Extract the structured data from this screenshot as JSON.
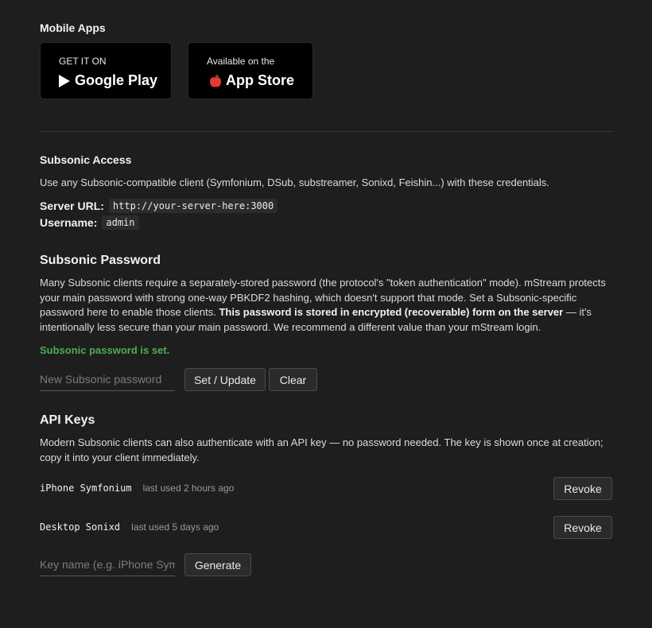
{
  "mobile": {
    "heading": "Mobile Apps",
    "google": {
      "small": "GET IT ON",
      "big": "Google Play"
    },
    "apple": {
      "small": "Available on the",
      "big": "App Store"
    }
  },
  "subsonic_access": {
    "heading": "Subsonic Access",
    "description": "Use any Subsonic-compatible client (Symfonium, DSub, substreamer, Sonixd, Feishin...) with these credentials.",
    "server_url_label": "Server URL:",
    "server_url_value": "http://your-server-here:3000",
    "username_label": "Username:",
    "username_value": "admin"
  },
  "subsonic_password": {
    "heading": "Subsonic Password",
    "para_before": "Many Subsonic clients require a separately-stored password (the protocol's \"token authentication\" mode). mStream protects your main password with strong one-way PBKDF2 hashing, which doesn't support that mode. Set a Subsonic-specific password here to enable those clients. ",
    "para_bold": "This password is stored in encrypted (recoverable) form on the server",
    "para_after": " — it's intentionally less secure than your main password. We recommend a different value than your mStream login.",
    "status": "Subsonic password is set.",
    "input_placeholder": "New Subsonic password",
    "set_button": "Set / Update",
    "clear_button": "Clear"
  },
  "api_keys": {
    "heading": "API Keys",
    "description": "Modern Subsonic clients can also authenticate with an API key — no password needed. The key is shown once at creation; copy it into your client immediately.",
    "keys": [
      {
        "name": "iPhone Symfonium",
        "meta": "last used 2 hours ago",
        "action": "Revoke"
      },
      {
        "name": "Desktop Sonixd",
        "meta": "last used 5 days ago",
        "action": "Revoke"
      }
    ],
    "input_placeholder": "Key name (e.g. iPhone Symfonium)",
    "generate_button": "Generate"
  }
}
